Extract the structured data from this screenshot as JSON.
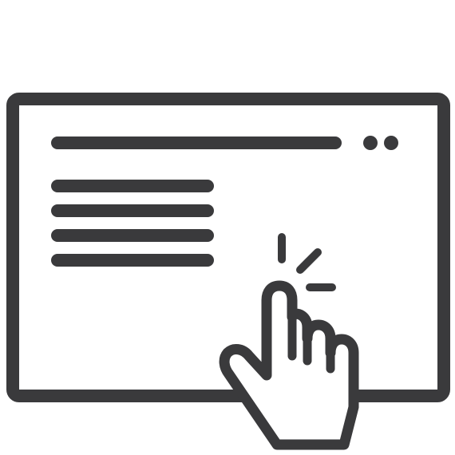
{
  "icon": {
    "name": "web-page-click-icon",
    "stroke_color": "#3a3a3c",
    "fill_color": "#ffffff",
    "parts": {
      "window": "browser-window-icon",
      "address_bar": "address-bar-line",
      "window_controls": "window-dots",
      "text_lines": "text-lines",
      "cursor": "pointing-hand-icon",
      "click_burst": "click-burst-icon"
    }
  }
}
